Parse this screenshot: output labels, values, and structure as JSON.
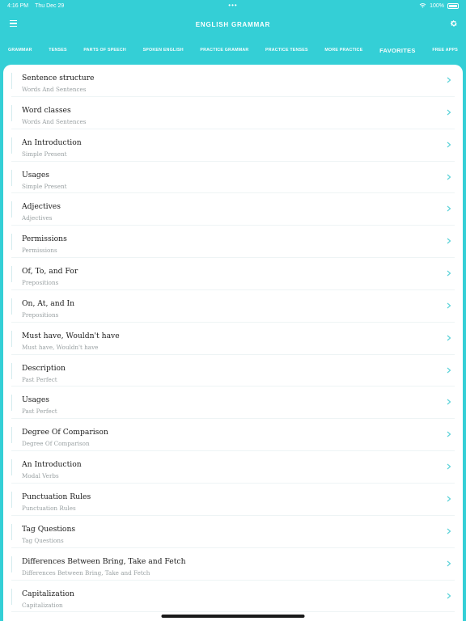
{
  "status": {
    "time": "4:16 PM",
    "date": "Thu Dec 29",
    "battery": "100%"
  },
  "header": {
    "title": "ENGLISH GRAMMAR"
  },
  "tabs": [
    {
      "label": "GRAMMAR"
    },
    {
      "label": "TENSES"
    },
    {
      "label": "PARTS OF SPEECH"
    },
    {
      "label": "SPOKEN ENGLISH"
    },
    {
      "label": "PRACTICE GRAMMAR"
    },
    {
      "label": "PRACTICE TENSES"
    },
    {
      "label": "MORE PRACTICE"
    },
    {
      "label": "FAVORITES"
    },
    {
      "label": "FREE APPS"
    }
  ],
  "active_tab": "FAVORITES",
  "colors": {
    "accent": "#34cfd6",
    "chevron": "#5ed3d9"
  },
  "favorites": [
    {
      "title": "Sentence structure",
      "subtitle": "Words And Sentences"
    },
    {
      "title": "Word classes",
      "subtitle": "Words And Sentences"
    },
    {
      "title": "An Introduction",
      "subtitle": "Simple Present"
    },
    {
      "title": "Usages",
      "subtitle": "Simple Present"
    },
    {
      "title": "Adjectives",
      "subtitle": "Adjectives"
    },
    {
      "title": "Permissions",
      "subtitle": "Permissions"
    },
    {
      "title": "Of, To, and For",
      "subtitle": "Prepositions"
    },
    {
      "title": "On, At, and In",
      "subtitle": "Prepositions"
    },
    {
      "title": "Must have, Wouldn't have",
      "subtitle": "Must have, Wouldn't have"
    },
    {
      "title": "Description",
      "subtitle": "Past Perfect"
    },
    {
      "title": "Usages",
      "subtitle": "Past Perfect"
    },
    {
      "title": "Degree Of Comparison",
      "subtitle": "Degree Of Comparison"
    },
    {
      "title": "An Introduction",
      "subtitle": "Modal Verbs"
    },
    {
      "title": "Punctuation Rules",
      "subtitle": "Punctuation Rules"
    },
    {
      "title": "Tag Questions",
      "subtitle": "Tag Questions"
    },
    {
      "title": "Differences Between Bring, Take and Fetch",
      "subtitle": "Differences Between Bring, Take and Fetch"
    },
    {
      "title": "Capitalization",
      "subtitle": "Capitalization"
    }
  ]
}
